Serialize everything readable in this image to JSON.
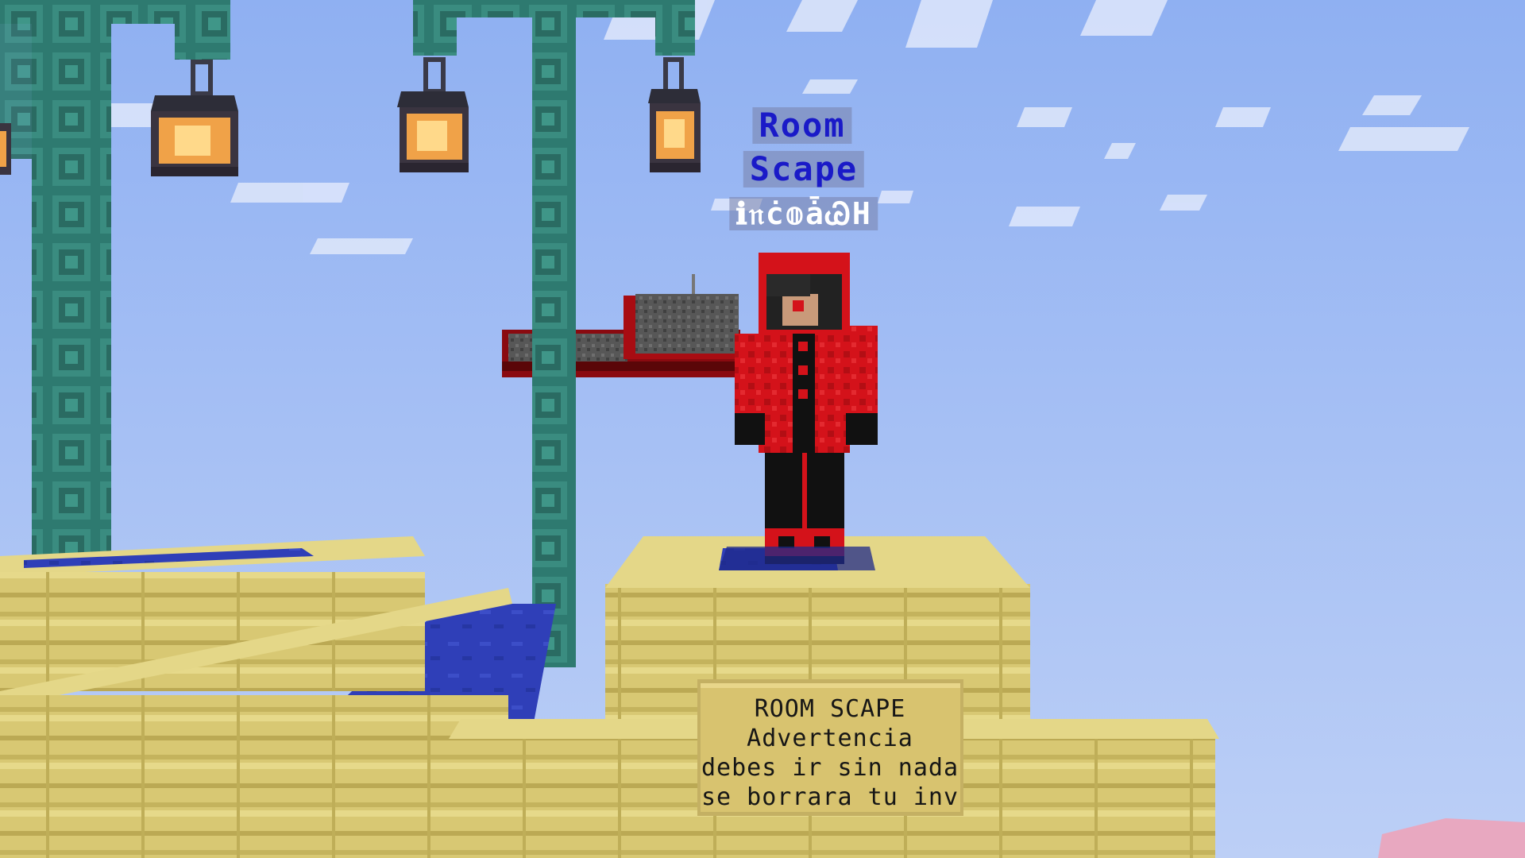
{
  "nametag": {
    "line1": "Room",
    "line2": "Scape",
    "line3": "ℹ𝔫ċ𝕠ǡᏊH",
    "title_color": "#1a1ac8",
    "third_color": "#ffffff"
  },
  "sign": {
    "lines": [
      "ROOM SCAPE",
      "Advertencia",
      "debes ir sin nada",
      "se borrara tu inv"
    ]
  },
  "colors": {
    "sky_top": "#8fb0f2",
    "sky_bottom": "#b8ccf5",
    "prismarine": "#2e7a70",
    "sandstone": "#d6c76e",
    "water": "#2f3fb8",
    "robe_red": "#d4121a"
  }
}
